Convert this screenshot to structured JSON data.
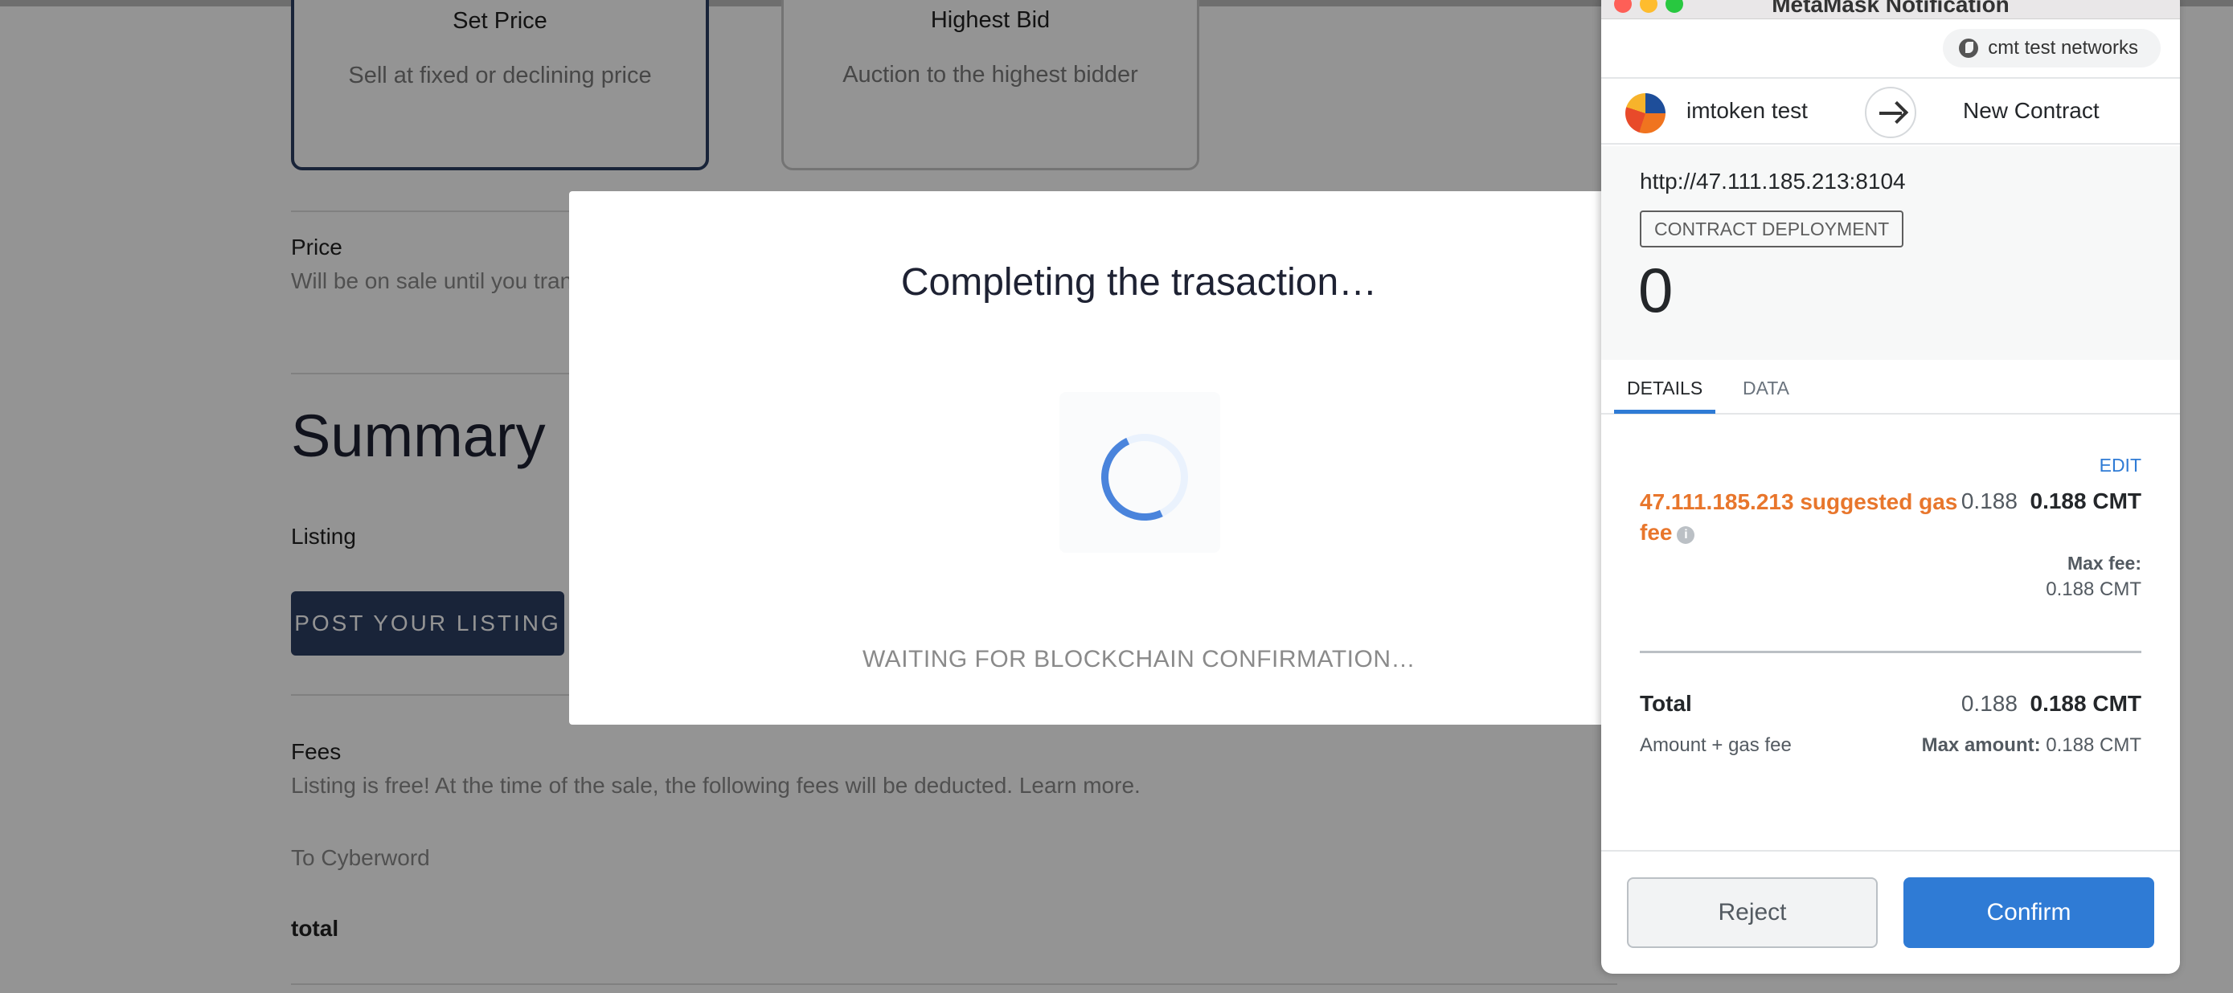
{
  "listing": {
    "set_price": {
      "title": "Set Price",
      "subtitle": "Sell at fixed or declining price"
    },
    "highest_bid": {
      "title": "Highest Bid",
      "subtitle": "Auction to the highest bidder"
    },
    "price_label": "Price",
    "price_hint": "Will be on sale until you tran",
    "summary_title": "Summary",
    "listing_label": "Listing",
    "post_button": "POST YOUR LISTING",
    "fees_label": "Fees",
    "fees_text": "Listing is free! At the time of the sale, the following fees will be deducted. Learn more.",
    "to_cyberword": "To Cyberword",
    "total_label": "total"
  },
  "modal": {
    "title": "Completing the trasaction…",
    "status": "WAITING FOR BLOCKCHAIN CONFIRMATION…"
  },
  "metamask": {
    "window_title": "MetaMask Notification",
    "network": "cmt test networks",
    "account_name": "imtoken test",
    "recipient": "New Contract",
    "origin": "http://47.111.185.213:8104",
    "tx_type_badge": "CONTRACT DEPLOYMENT",
    "amount": "0",
    "tabs": [
      {
        "label": "DETAILS",
        "active": true
      },
      {
        "label": "DATA",
        "active": false
      }
    ],
    "edit_label": "EDIT",
    "gas_fee_label": "47.111.185.213 suggested gas fee",
    "gas_fee_secondary": "0.188",
    "gas_fee_primary": "0.188 CMT",
    "max_fee_label": "Max fee:",
    "max_fee_value": "0.188 CMT",
    "total_label": "Total",
    "total_secondary": "0.188",
    "total_primary": "0.188 CMT",
    "amount_gas_label": "Amount + gas fee",
    "max_amount_label": "Max amount:",
    "max_amount_value": "0.188 CMT",
    "reject_label": "Reject",
    "confirm_label": "Confirm",
    "colors": {
      "primary_blue": "#2f7bd5",
      "gas_orange": "#e8762c"
    }
  }
}
